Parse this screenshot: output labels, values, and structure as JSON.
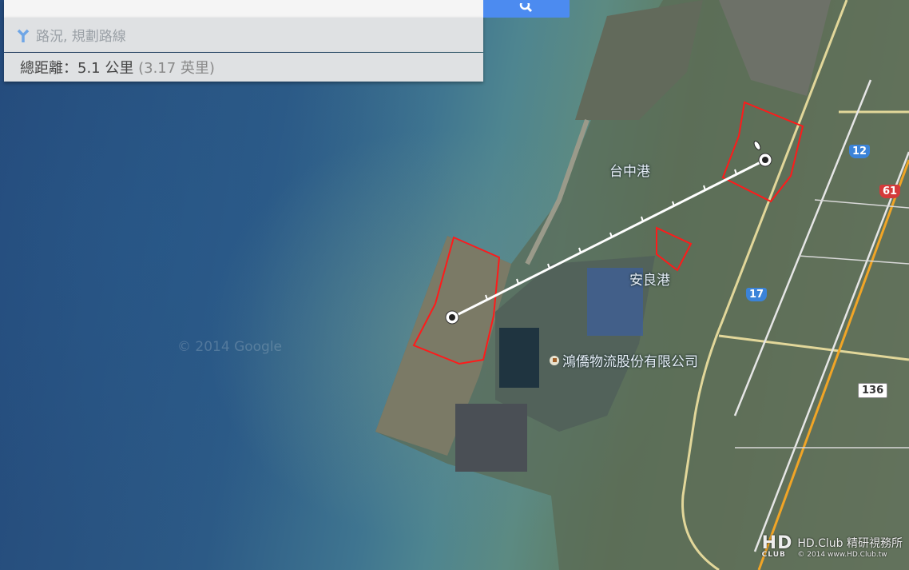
{
  "search": {
    "placeholder": ""
  },
  "directions": {
    "label": "路況, 規劃路線"
  },
  "distance": {
    "prefix": "總距離：",
    "km": "5.1 公里",
    "miles": "(3.17 英里)"
  },
  "map": {
    "labels": {
      "port1": "台中港",
      "port2": "安良港",
      "poi": "鴻僑物流股份有限公司"
    },
    "roads": [
      "12",
      "61",
      "17",
      "136"
    ],
    "google_watermark": "© 2014 Google",
    "colors": {
      "outline": "#ff1a1a",
      "measure_line": "#ffffff",
      "search_button": "#4c8bf0"
    }
  },
  "watermark": {
    "brand": "HD.Club 精研視務所",
    "line2": "© 2014  www.HD.Club.tw",
    "logo": "HD CLUB"
  }
}
